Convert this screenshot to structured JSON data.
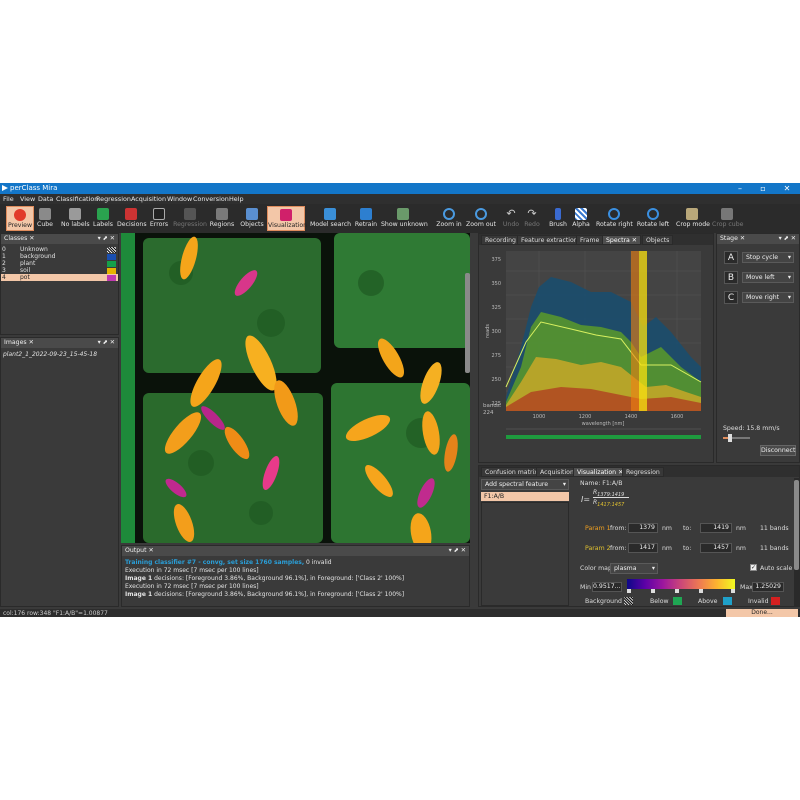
{
  "window": {
    "title": "perClass Mira"
  },
  "menu": [
    "File",
    "View",
    "Data",
    "Classification",
    "Regression",
    "Acquisition",
    "Window",
    "Conversion",
    "Help"
  ],
  "toolbar": {
    "preview": "Preview",
    "cube": "Cube",
    "no_labels": "No labels",
    "labels": "Labels",
    "decisions": "Decisions",
    "errors": "Errors",
    "regression": "Regression",
    "regions": "Regions",
    "objects": "Objects",
    "visualization": "Visualization",
    "model_search": "Model search",
    "retrain": "Retrain",
    "show_unknown": "Show unknown",
    "zoom_in": "Zoom in",
    "zoom_out": "Zoom out",
    "undo": "Undo",
    "redo": "Redo",
    "brush": "Brush",
    "alpha": "Alpha",
    "rotate_right": "Rotate right",
    "rotate_left": "Rotate left",
    "crop_mode": "Crop mode",
    "crop_cube": "Crop cube"
  },
  "classes_panel": {
    "title": "Classes",
    "rows": [
      {
        "idx": "0",
        "name": "Unknown",
        "color": "#3a3a3a"
      },
      {
        "idx": "1",
        "name": "background",
        "color": "#1a4fb0"
      },
      {
        "idx": "2",
        "name": "plant",
        "color": "#15a04a"
      },
      {
        "idx": "3",
        "name": "soil",
        "color": "#e6b400"
      },
      {
        "idx": "4",
        "name": "pot",
        "color": "#c03ab0"
      }
    ]
  },
  "images_panel": {
    "title": "Images",
    "item": "plant2_1_2022-09-23_15-45-18"
  },
  "output_panel": {
    "title": "Output",
    "line1_head": "Training classifier #7 - convg, set size 1760 samples,",
    "line1_tail": " 0 invalid",
    "line2": "Execution in 72 msec [7 msec per 100 lines]",
    "line3_head": "Image 1",
    "line3_tail": " decisions: [Foreground 3.86%, Background 96.1%], in Foreground: ['Class 2' 100%]",
    "line4": "Execution in 72 msec [7 msec per 100 lines]",
    "line5_head": "Image 1",
    "line5_tail": " decisions: [Foreground 3.86%, Background 96.1%], in Foreground: ['Class 2' 100%]"
  },
  "spectra_tabs": [
    "Recording",
    "Feature extraction",
    "Frame",
    "Spectra",
    "Objects"
  ],
  "spectra": {
    "xlabel": "wavelength [nm]",
    "ylabel": "reads",
    "yticks": [
      "375",
      "350",
      "325",
      "300",
      "275",
      "250",
      "225"
    ],
    "xticks": [
      "1000",
      "1200",
      "1400",
      "1600"
    ],
    "bands_label": "bands:",
    "bands_value": "224"
  },
  "stage": {
    "title": "Stage",
    "rows": [
      {
        "key": "A",
        "action": "Stop cycle"
      },
      {
        "key": "B",
        "action": "Move left"
      },
      {
        "key": "C",
        "action": "Move right"
      }
    ],
    "speed": "Speed: 15.8 mm/s",
    "speed_fraction": 0.25,
    "disconnect": "Disconnect"
  },
  "bottom_tabs": [
    "Confusion matrix",
    "Acquisition",
    "Visualization",
    "Regression"
  ],
  "visualization": {
    "add_feature": "Add spectral feature",
    "feature": "F1:A/B",
    "name_label": "Name: F1:A/B",
    "formula_r1": "R",
    "formula_r1_sub": "1379:1419",
    "formula_r2": "R",
    "formula_r2_sub": "1417:1457",
    "param1": {
      "label": "Param 1",
      "from_label": "from:",
      "from": "1379",
      "unit": "nm",
      "to_label": "to:",
      "to": "1419",
      "bands": "11 bands"
    },
    "param2": {
      "label": "Param 2",
      "from_label": "from:",
      "from": "1417",
      "unit": "nm",
      "to_label": "to:",
      "to": "1457",
      "bands": "11 bands"
    },
    "colormap_label": "Color map",
    "colormap": "plasma",
    "autoscale": "Auto scale",
    "min_label": "Min",
    "min": "0.9517...",
    "max_label": "Max",
    "max": "1.25029",
    "background_label": "Background",
    "below_label": "Below",
    "above_label": "Above",
    "invalid_label": "Invalid",
    "below_color": "#1fa653",
    "above_color": "#1fa0c8",
    "invalid_color": "#d42020",
    "done": "Done"
  },
  "status": {
    "text": "col:176 row:348 \"F1:A/B\"=1.00877"
  }
}
